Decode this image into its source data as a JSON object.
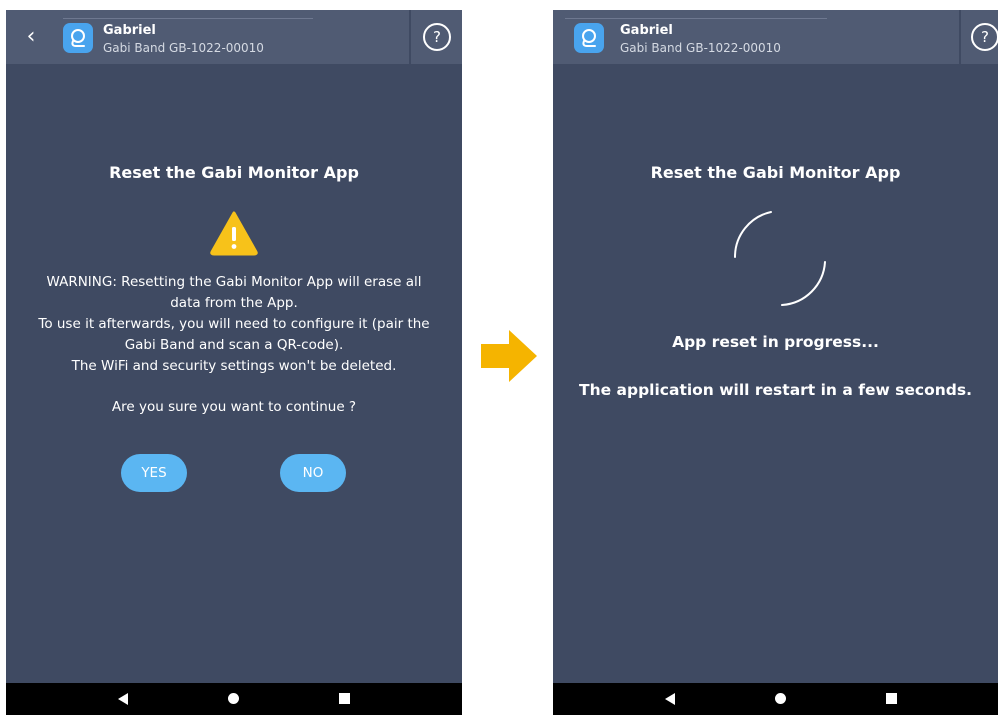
{
  "header": {
    "name": "Gabriel",
    "device": "Gabi Band GB-1022-00010",
    "help_label": "?"
  },
  "confirm_screen": {
    "title": "Reset the Gabi Monitor App",
    "warning_lines": [
      "WARNING: Resetting the Gabi Monitor App will erase all",
      "data from the App.",
      "To use it afterwards, you will need to configure it (pair the",
      "Gabi Band and scan a QR-code).",
      "The WiFi and security settings won't be deleted."
    ],
    "question": "Are you sure you want to continue ?",
    "yes_label": "YES",
    "no_label": "NO"
  },
  "progress_screen": {
    "title": "Reset the Gabi Monitor App",
    "status": "App reset in progress...",
    "message": "The application will restart in a few seconds."
  },
  "colors": {
    "screen_bg": "#3f4a62",
    "topbar_bg": "#505b73",
    "button": "#5bb6f2",
    "warning": "#f7c21a",
    "arrow": "#f5b400"
  },
  "icons": {
    "back": "chevron-left",
    "avatar": "gabi-logo",
    "help": "question-circle",
    "warning": "warning-triangle",
    "spinner": "loading-spinner",
    "arrow": "right-arrow"
  }
}
